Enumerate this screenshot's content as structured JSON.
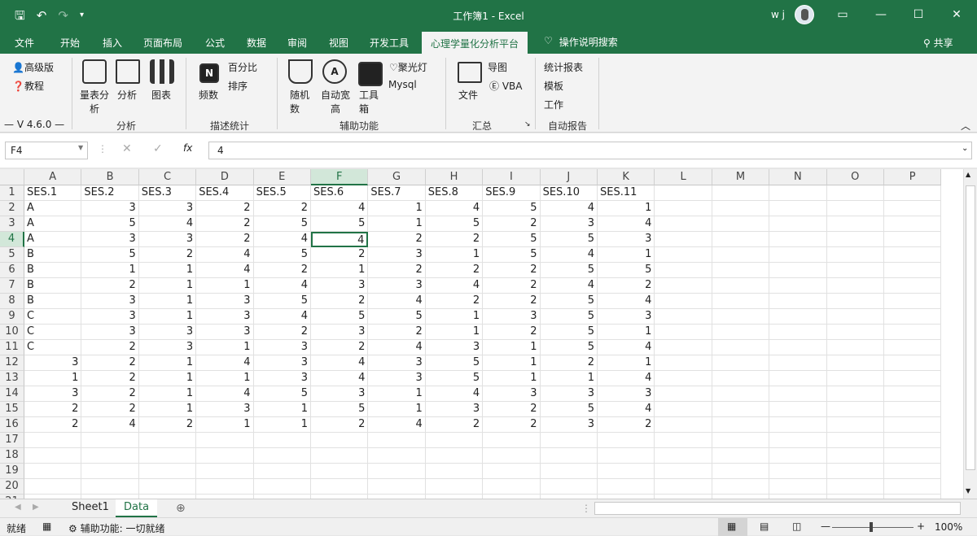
{
  "window": {
    "title": "工作簿1 - Excel",
    "user": "w j"
  },
  "tabs": [
    "文件",
    "开始",
    "插入",
    "页面布局",
    "公式",
    "数据",
    "审阅",
    "视图",
    "开发工具",
    "心理学量化分析平台"
  ],
  "tell_me": "操作说明搜索",
  "share": "共享",
  "ribbon": {
    "premium": "高级版",
    "tutorial": "教程",
    "version": "— V 4.6.0 —",
    "scale": "量表分析",
    "analysis": "分析",
    "chart": "图表",
    "group_analysis": "分析",
    "freq": "频数",
    "percent": "百分比",
    "sort": "排序",
    "group_desc": "描述统计",
    "random": "随机数",
    "autofit": "自动宽高",
    "toolbox": "工具箱",
    "spotlight": "聚光灯",
    "mysql": "Mysql",
    "group_aux": "辅助功能",
    "file": "文件",
    "guide": "导图",
    "vba": "VBA",
    "group_summary": "汇总",
    "stat_report": "统计报表",
    "template": "模板",
    "work": "工作",
    "group_report": "自动报告"
  },
  "formula_bar": {
    "name_box": "F4",
    "value": "4"
  },
  "columns": [
    "A",
    "B",
    "C",
    "D",
    "E",
    "F",
    "G",
    "H",
    "I",
    "J",
    "K",
    "L",
    "M",
    "N",
    "O",
    "P"
  ],
  "rows": [
    [
      "SES.1",
      "SES.2",
      "SES.3",
      "SES.4",
      "SES.5",
      "SES.6",
      "SES.7",
      "SES.8",
      "SES.9",
      "SES.10",
      "SES.11"
    ],
    [
      "A",
      "3",
      "3",
      "2",
      "2",
      "4",
      "1",
      "4",
      "5",
      "4",
      "1"
    ],
    [
      "A",
      "5",
      "4",
      "2",
      "5",
      "5",
      "1",
      "5",
      "2",
      "3",
      "4"
    ],
    [
      "A",
      "3",
      "3",
      "2",
      "4",
      "4",
      "2",
      "2",
      "5",
      "5",
      "3"
    ],
    [
      "B",
      "5",
      "2",
      "4",
      "5",
      "2",
      "3",
      "1",
      "5",
      "4",
      "1"
    ],
    [
      "B",
      "1",
      "1",
      "4",
      "2",
      "1",
      "2",
      "2",
      "2",
      "5",
      "5"
    ],
    [
      "B",
      "2",
      "1",
      "1",
      "4",
      "3",
      "3",
      "4",
      "2",
      "4",
      "2"
    ],
    [
      "B",
      "3",
      "1",
      "3",
      "5",
      "2",
      "4",
      "2",
      "2",
      "5",
      "4"
    ],
    [
      "C",
      "3",
      "1",
      "3",
      "4",
      "5",
      "5",
      "1",
      "3",
      "5",
      "3"
    ],
    [
      "C",
      "3",
      "3",
      "3",
      "2",
      "3",
      "2",
      "1",
      "2",
      "5",
      "1"
    ],
    [
      "C",
      "2",
      "3",
      "1",
      "3",
      "2",
      "4",
      "3",
      "1",
      "5",
      "4"
    ],
    [
      "3",
      "2",
      "1",
      "4",
      "3",
      "4",
      "3",
      "5",
      "1",
      "2",
      "1"
    ],
    [
      "1",
      "2",
      "1",
      "1",
      "3",
      "4",
      "3",
      "5",
      "1",
      "1",
      "4"
    ],
    [
      "3",
      "2",
      "1",
      "4",
      "5",
      "3",
      "1",
      "4",
      "3",
      "3",
      "3"
    ],
    [
      "2",
      "2",
      "1",
      "3",
      "1",
      "5",
      "1",
      "3",
      "2",
      "5",
      "4"
    ],
    [
      "2",
      "4",
      "2",
      "1",
      "1",
      "2",
      "4",
      "2",
      "2",
      "3",
      "2"
    ],
    [],
    [],
    [],
    [],
    []
  ],
  "sheets": [
    "Sheet1",
    "Data"
  ],
  "status": {
    "ready": "就绪",
    "accessibility": "辅助功能: 一切就绪",
    "zoom": "100%"
  }
}
